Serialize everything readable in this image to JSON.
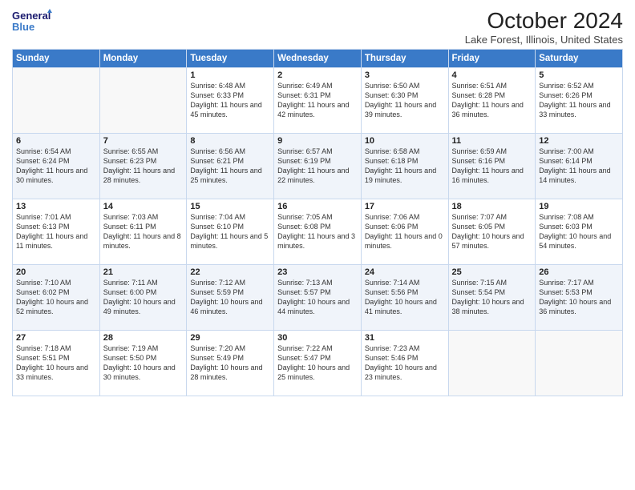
{
  "header": {
    "logo_line1": "General",
    "logo_line2": "Blue",
    "month": "October 2024",
    "location": "Lake Forest, Illinois, United States"
  },
  "days_of_week": [
    "Sunday",
    "Monday",
    "Tuesday",
    "Wednesday",
    "Thursday",
    "Friday",
    "Saturday"
  ],
  "weeks": [
    [
      {
        "day": "",
        "content": ""
      },
      {
        "day": "",
        "content": ""
      },
      {
        "day": "1",
        "content": "Sunrise: 6:48 AM\nSunset: 6:33 PM\nDaylight: 11 hours and 45 minutes."
      },
      {
        "day": "2",
        "content": "Sunrise: 6:49 AM\nSunset: 6:31 PM\nDaylight: 11 hours and 42 minutes."
      },
      {
        "day": "3",
        "content": "Sunrise: 6:50 AM\nSunset: 6:30 PM\nDaylight: 11 hours and 39 minutes."
      },
      {
        "day": "4",
        "content": "Sunrise: 6:51 AM\nSunset: 6:28 PM\nDaylight: 11 hours and 36 minutes."
      },
      {
        "day": "5",
        "content": "Sunrise: 6:52 AM\nSunset: 6:26 PM\nDaylight: 11 hours and 33 minutes."
      }
    ],
    [
      {
        "day": "6",
        "content": "Sunrise: 6:54 AM\nSunset: 6:24 PM\nDaylight: 11 hours and 30 minutes."
      },
      {
        "day": "7",
        "content": "Sunrise: 6:55 AM\nSunset: 6:23 PM\nDaylight: 11 hours and 28 minutes."
      },
      {
        "day": "8",
        "content": "Sunrise: 6:56 AM\nSunset: 6:21 PM\nDaylight: 11 hours and 25 minutes."
      },
      {
        "day": "9",
        "content": "Sunrise: 6:57 AM\nSunset: 6:19 PM\nDaylight: 11 hours and 22 minutes."
      },
      {
        "day": "10",
        "content": "Sunrise: 6:58 AM\nSunset: 6:18 PM\nDaylight: 11 hours and 19 minutes."
      },
      {
        "day": "11",
        "content": "Sunrise: 6:59 AM\nSunset: 6:16 PM\nDaylight: 11 hours and 16 minutes."
      },
      {
        "day": "12",
        "content": "Sunrise: 7:00 AM\nSunset: 6:14 PM\nDaylight: 11 hours and 14 minutes."
      }
    ],
    [
      {
        "day": "13",
        "content": "Sunrise: 7:01 AM\nSunset: 6:13 PM\nDaylight: 11 hours and 11 minutes."
      },
      {
        "day": "14",
        "content": "Sunrise: 7:03 AM\nSunset: 6:11 PM\nDaylight: 11 hours and 8 minutes."
      },
      {
        "day": "15",
        "content": "Sunrise: 7:04 AM\nSunset: 6:10 PM\nDaylight: 11 hours and 5 minutes."
      },
      {
        "day": "16",
        "content": "Sunrise: 7:05 AM\nSunset: 6:08 PM\nDaylight: 11 hours and 3 minutes."
      },
      {
        "day": "17",
        "content": "Sunrise: 7:06 AM\nSunset: 6:06 PM\nDaylight: 11 hours and 0 minutes."
      },
      {
        "day": "18",
        "content": "Sunrise: 7:07 AM\nSunset: 6:05 PM\nDaylight: 10 hours and 57 minutes."
      },
      {
        "day": "19",
        "content": "Sunrise: 7:08 AM\nSunset: 6:03 PM\nDaylight: 10 hours and 54 minutes."
      }
    ],
    [
      {
        "day": "20",
        "content": "Sunrise: 7:10 AM\nSunset: 6:02 PM\nDaylight: 10 hours and 52 minutes."
      },
      {
        "day": "21",
        "content": "Sunrise: 7:11 AM\nSunset: 6:00 PM\nDaylight: 10 hours and 49 minutes."
      },
      {
        "day": "22",
        "content": "Sunrise: 7:12 AM\nSunset: 5:59 PM\nDaylight: 10 hours and 46 minutes."
      },
      {
        "day": "23",
        "content": "Sunrise: 7:13 AM\nSunset: 5:57 PM\nDaylight: 10 hours and 44 minutes."
      },
      {
        "day": "24",
        "content": "Sunrise: 7:14 AM\nSunset: 5:56 PM\nDaylight: 10 hours and 41 minutes."
      },
      {
        "day": "25",
        "content": "Sunrise: 7:15 AM\nSunset: 5:54 PM\nDaylight: 10 hours and 38 minutes."
      },
      {
        "day": "26",
        "content": "Sunrise: 7:17 AM\nSunset: 5:53 PM\nDaylight: 10 hours and 36 minutes."
      }
    ],
    [
      {
        "day": "27",
        "content": "Sunrise: 7:18 AM\nSunset: 5:51 PM\nDaylight: 10 hours and 33 minutes."
      },
      {
        "day": "28",
        "content": "Sunrise: 7:19 AM\nSunset: 5:50 PM\nDaylight: 10 hours and 30 minutes."
      },
      {
        "day": "29",
        "content": "Sunrise: 7:20 AM\nSunset: 5:49 PM\nDaylight: 10 hours and 28 minutes."
      },
      {
        "day": "30",
        "content": "Sunrise: 7:22 AM\nSunset: 5:47 PM\nDaylight: 10 hours and 25 minutes."
      },
      {
        "day": "31",
        "content": "Sunrise: 7:23 AM\nSunset: 5:46 PM\nDaylight: 10 hours and 23 minutes."
      },
      {
        "day": "",
        "content": ""
      },
      {
        "day": "",
        "content": ""
      }
    ]
  ]
}
